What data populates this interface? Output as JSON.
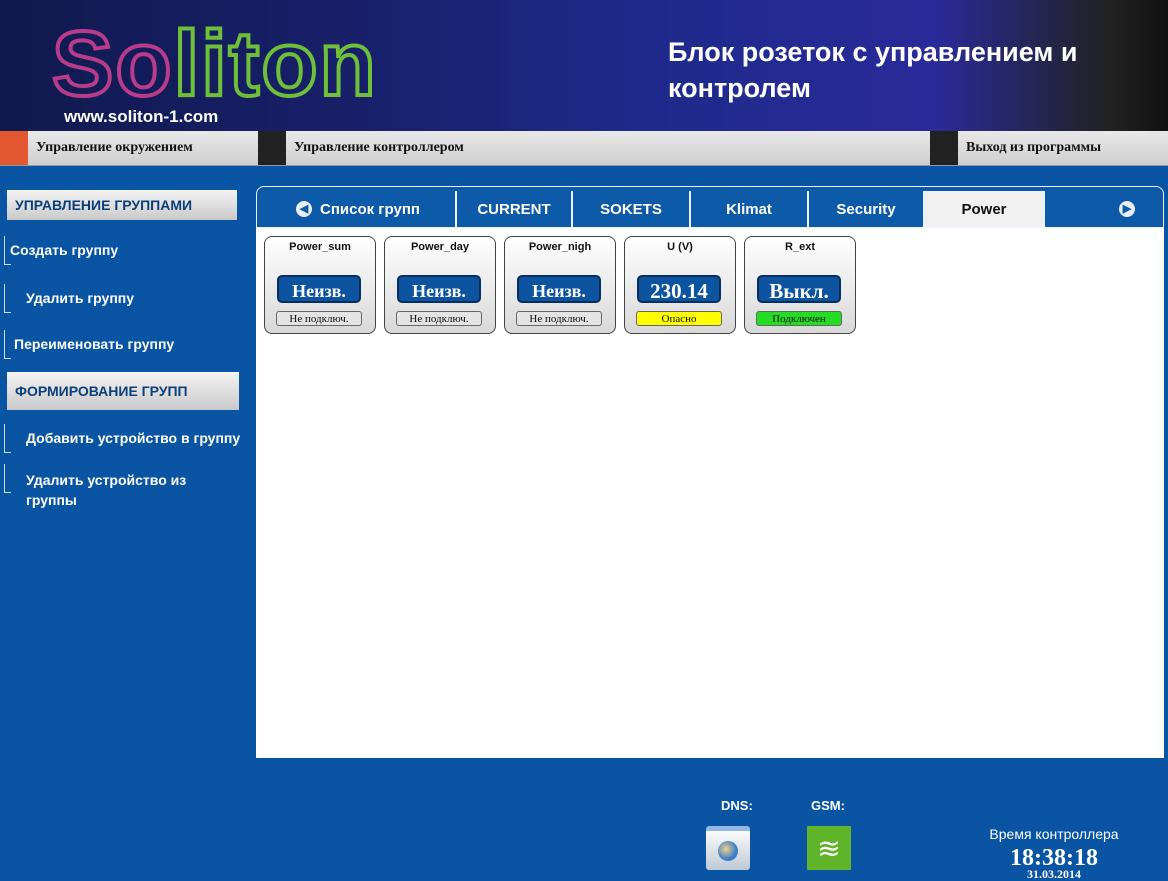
{
  "header": {
    "logo": "Soliton",
    "url": "www.soliton-1.com",
    "title": "Блок розеток с управлением и контролем"
  },
  "top_menu": {
    "items": [
      {
        "label": "Управление окружением",
        "color": "#e2572f"
      },
      {
        "label": "Управление контроллером",
        "color": "#222222"
      },
      {
        "label": "Выход из программы",
        "color": "#222222"
      }
    ]
  },
  "sidebar": {
    "group_mgmt_title": "УПРАВЛЕНИЕ ГРУППАМИ",
    "create": "Создать группу",
    "delete": "Удалить группу",
    "rename": "Переименовать группу",
    "forming_title": "ФОРМИРОВАНИЕ ГРУПП",
    "add_device": "Добавить устройство в группу",
    "remove_device": "Удалить устройство из группы"
  },
  "tabs": {
    "groups_list": "Список групп",
    "t1": "CURRENT",
    "t2": "SOKETS",
    "t3": "Klimat",
    "t4": "Security",
    "t5": "Power",
    "active": "Power"
  },
  "widgets": [
    {
      "label": "Power_sum",
      "value": "Неизв.",
      "status": "Не подключ.",
      "status_color": "#e3e3e3"
    },
    {
      "label": "Power_day",
      "value": "Неизв.",
      "status": "Не подключ.",
      "status_color": "#e3e3e3"
    },
    {
      "label": "Power_nigh",
      "value": "Неизв.",
      "status": "Не подключ.",
      "status_color": "#e3e3e3"
    },
    {
      "label": "U (V)",
      "value": "230.14",
      "status": "Опасно",
      "status_color": "#ffff00"
    },
    {
      "label": "R_ext",
      "value": "Выкл.",
      "status": "Подключен",
      "status_color": "#22dd22"
    }
  ],
  "footer": {
    "dns_label": "DNS:",
    "gsm_label": "GSM:",
    "time_label": "Время контроллера",
    "time": "18:38:18",
    "date": "31.03.2014"
  },
  "icons": {
    "arrow_left": "arrow-left-icon",
    "arrow_right": "arrow-right-icon",
    "dns": "globe-icon",
    "gsm": "wifi-signal-icon"
  }
}
